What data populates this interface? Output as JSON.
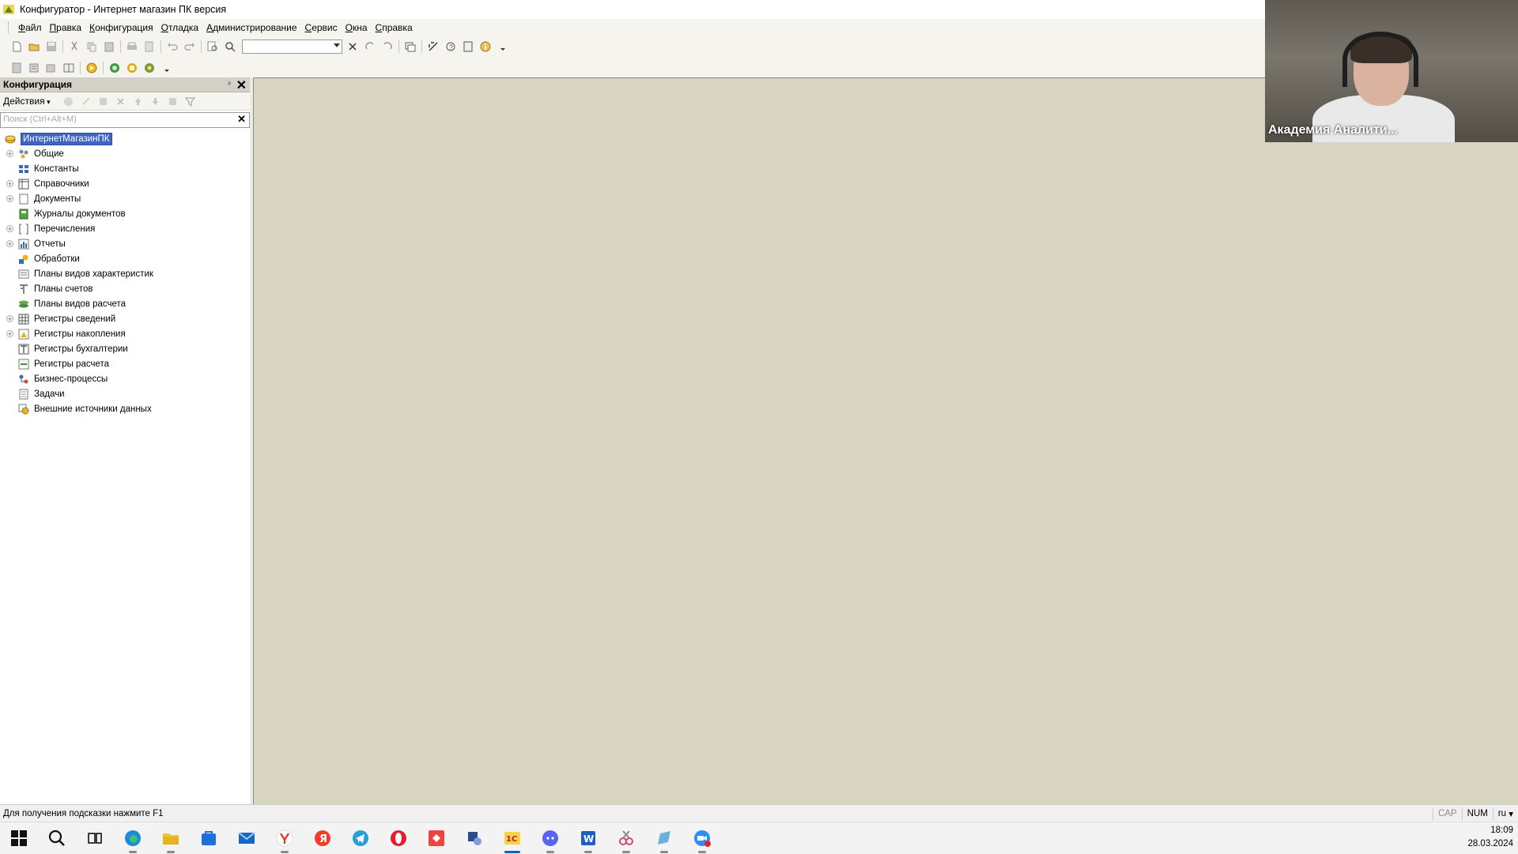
{
  "window": {
    "title": "Конфигуратор - Интернет магазин ПК версия"
  },
  "menu": [
    "Файл",
    "Правка",
    "Конфигурация",
    "Отладка",
    "Администрирование",
    "Сервис",
    "Окна",
    "Справка"
  ],
  "panel": {
    "title": "Конфигурация",
    "actions_label": "Действия",
    "search_placeholder": "Поиск (Ctrl+Alt+M)",
    "root": "ИнтернетМагазинПК",
    "items": [
      {
        "label": "Общие",
        "expandable": true,
        "icon": "common-icon"
      },
      {
        "label": "Константы",
        "expandable": false,
        "icon": "constants-icon"
      },
      {
        "label": "Справочники",
        "expandable": true,
        "icon": "catalogs-icon"
      },
      {
        "label": "Документы",
        "expandable": true,
        "icon": "documents-icon"
      },
      {
        "label": "Журналы документов",
        "expandable": false,
        "icon": "journals-icon"
      },
      {
        "label": "Перечисления",
        "expandable": true,
        "icon": "enums-icon"
      },
      {
        "label": "Отчеты",
        "expandable": true,
        "icon": "reports-icon"
      },
      {
        "label": "Обработки",
        "expandable": false,
        "icon": "processing-icon"
      },
      {
        "label": "Планы видов характеристик",
        "expandable": false,
        "icon": "chart-of-characteristics-icon"
      },
      {
        "label": "Планы счетов",
        "expandable": false,
        "icon": "chart-of-accounts-icon"
      },
      {
        "label": "Планы видов расчета",
        "expandable": false,
        "icon": "chart-of-calculation-icon"
      },
      {
        "label": "Регистры сведений",
        "expandable": true,
        "icon": "info-registers-icon"
      },
      {
        "label": "Регистры накопления",
        "expandable": true,
        "icon": "accumulation-registers-icon"
      },
      {
        "label": "Регистры бухгалтерии",
        "expandable": false,
        "icon": "accounting-registers-icon"
      },
      {
        "label": "Регистры расчета",
        "expandable": false,
        "icon": "calculation-registers-icon"
      },
      {
        "label": "Бизнес-процессы",
        "expandable": false,
        "icon": "business-processes-icon"
      },
      {
        "label": "Задачи",
        "expandable": false,
        "icon": "tasks-icon"
      },
      {
        "label": "Внешние источники данных",
        "expandable": false,
        "icon": "external-sources-icon"
      }
    ]
  },
  "status": {
    "hint": "Для получения подсказки нажмите F1",
    "cap": "CAP",
    "num": "NUM",
    "lang": "ru"
  },
  "video": {
    "label": "Академия Аналити..."
  },
  "taskbar": {
    "time": "18:09",
    "date": "28.03.2024",
    "apps": [
      "windows-start",
      "search",
      "task-view",
      "edge",
      "file-explorer",
      "store",
      "mail",
      "yandex-browser",
      "yandex",
      "telegram",
      "opera",
      "anydesk",
      "app-generic",
      "1c",
      "discord",
      "word",
      "snipping",
      "notepad",
      "zoom"
    ]
  },
  "colors": {
    "workspace": "#d8d5c3",
    "selection": "#3f64c4"
  }
}
